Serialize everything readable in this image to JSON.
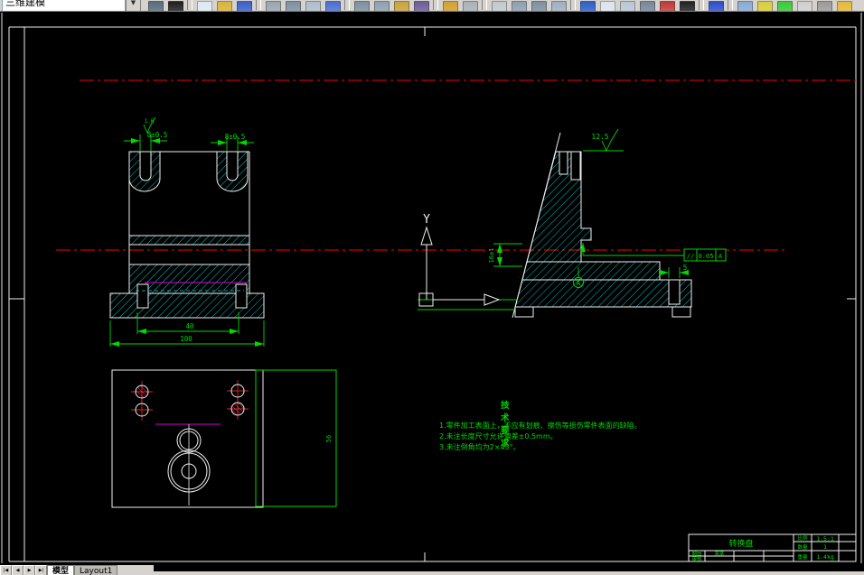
{
  "toolbar": {
    "workspace": "三维建模",
    "icons": [
      {
        "name": "find-icon",
        "color": "#5a6b7d"
      },
      {
        "name": "clean-screen-icon",
        "color": "#1f1f1f"
      },
      {
        "sep": true
      },
      {
        "name": "new-file-icon",
        "color": "#dce8f4"
      },
      {
        "name": "open-file-icon",
        "color": "#d8b23c"
      },
      {
        "name": "save-icon",
        "color": "#3a5fc8"
      },
      {
        "sep": true
      },
      {
        "name": "plot-icon",
        "color": "#9aa4ae"
      },
      {
        "name": "plot-preview-icon",
        "color": "#7d8fa0"
      },
      {
        "name": "publish-icon",
        "color": "#aebccb"
      },
      {
        "name": "hyperlink-icon",
        "color": "#4a6fd0"
      },
      {
        "sep": true
      },
      {
        "name": "cut-icon",
        "color": "#7d8fa0"
      },
      {
        "name": "copy-icon",
        "color": "#8fa0b0"
      },
      {
        "name": "paste-icon",
        "color": "#c8a23c"
      },
      {
        "name": "match-properties-icon",
        "color": "#6d5d96"
      },
      {
        "sep": true
      },
      {
        "name": "undo-icon",
        "color": "#d0a030"
      },
      {
        "name": "redo-icon",
        "color": "#a8b0b8"
      },
      {
        "sep": true
      },
      {
        "name": "pan-icon",
        "color": "#c2c8ce"
      },
      {
        "name": "zoom-realtime-icon",
        "color": "#8f9fb0"
      },
      {
        "name": "zoom-window-icon",
        "color": "#7d8fa0"
      },
      {
        "name": "zoom-previous-icon",
        "color": "#9fafc0"
      },
      {
        "sep": true
      },
      {
        "name": "text-style-icon",
        "color": "#2d5fc8"
      },
      {
        "name": "table-icon",
        "color": "#dae4ee"
      },
      {
        "name": "dimension-style-icon",
        "color": "#b8c6d4"
      },
      {
        "name": "sheet-set-icon",
        "color": "#76879a"
      },
      {
        "name": "markup-icon",
        "color": "#c03a3a"
      },
      {
        "name": "table-style-icon",
        "color": "#222222"
      },
      {
        "sep": true
      },
      {
        "name": "help-icon",
        "color": "#2d4fc8"
      },
      {
        "sep": true
      },
      {
        "name": "layers-icon",
        "color": "#88aad4"
      },
      {
        "name": "layer-properties-icon",
        "color": "#d8cc3a"
      },
      {
        "name": "color-control-icon",
        "color": "#3ac83a"
      },
      {
        "name": "linetype-icon",
        "color": "#cfcfcf"
      },
      {
        "name": "lineweight-icon",
        "color": "#9a9a9a"
      },
      {
        "name": "properties-icon",
        "color": "#e4b83c"
      }
    ]
  },
  "tabs": {
    "nav": [
      "|◀",
      "◀",
      "▶",
      "▶|"
    ],
    "model": "模型",
    "layout": "Layout1"
  },
  "drawing": {
    "dims": {
      "slot_left": "8±0.5",
      "slot_right": "8±0.5",
      "rough_left": "1.6",
      "rough_right": "12.5",
      "width_inner": "40",
      "width_outer": "100",
      "height_step": "16±1",
      "slot_depth": "5",
      "plan_height": "56",
      "tol_symbol": "//",
      "tol_value": "0.05",
      "tol_datum": "A",
      "datum_label": "A",
      "ucs_y": "Y"
    },
    "tech_req": {
      "title": "技术要求",
      "items": [
        "1.零件加工表面上，不应有划痕、擦伤等损伤零件表面的缺陷。",
        "2.未注长度尺寸允许偏差±0.5mm。",
        "3.未注倒角均为2×45°。"
      ]
    },
    "title_block": {
      "part_name": "转换盘",
      "scale_label": "比例",
      "scale_value": "1.5:1",
      "qty_label": "数量",
      "qty_value": "1",
      "weight_label": "重量",
      "weight_value": "1.4kg",
      "draw_label": "制图",
      "draw_name": "某某",
      "check_label": "审核"
    },
    "colors": {
      "background": "#000000",
      "object_line": "#f0f0f0",
      "dimension": "#00d800",
      "hatch": "#00d8d8",
      "centerline": "#c80000",
      "auxiliary": "#d800d8",
      "chrome": "#d6d3ce"
    }
  }
}
